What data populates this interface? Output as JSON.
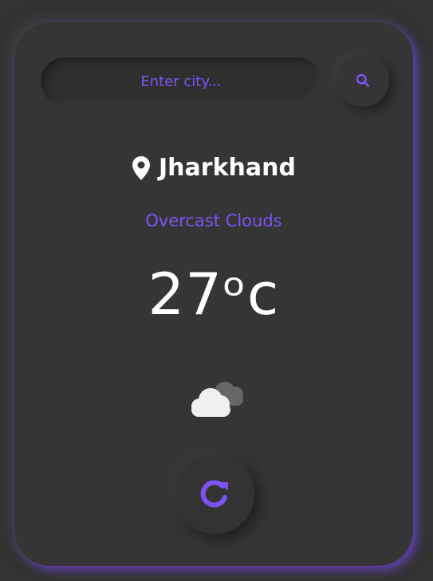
{
  "search": {
    "placeholder": "Enter city...",
    "button_icon": "search-icon"
  },
  "weather": {
    "location": "Jharkhand",
    "location_icon": "map-pin-icon",
    "condition": "Overcast Clouds",
    "temperature": "27",
    "unit": "ᵒc",
    "condition_icon": "overcast-clouds-icon"
  },
  "actions": {
    "refresh_icon": "refresh-icon"
  },
  "colors": {
    "accent": "#7D52F5",
    "background": "#333333",
    "card": "#353535",
    "text": "#FFFFFF"
  }
}
